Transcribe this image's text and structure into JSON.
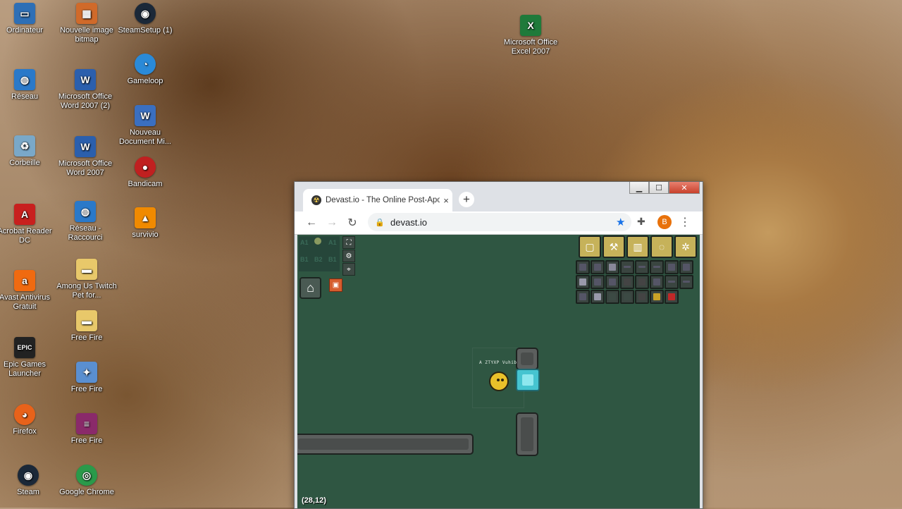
{
  "desktop": {
    "icons": [
      {
        "label": "Ordinateur",
        "icon": "computer-icon",
        "color": "#2e6fb6"
      },
      {
        "label": "Nouvelle image bitmap",
        "icon": "bitmap-icon",
        "color": "#d06a2a"
      },
      {
        "label": "SteamSetup (1)",
        "icon": "steam-icon",
        "color": "#1b2838"
      },
      {
        "label": "Réseau",
        "icon": "network-icon",
        "color": "#2a79c9"
      },
      {
        "label": "Microsoft Office Word 2007 (2)",
        "icon": "word-icon",
        "color": "#2b5fad"
      },
      {
        "label": "Gameloop",
        "icon": "gameloop-icon",
        "color": "#2a8ad8"
      },
      {
        "label": "Corbeille",
        "icon": "recycle-bin-icon",
        "color": "#7aa8c8"
      },
      {
        "label": "Microsoft Office Word 2007",
        "icon": "word-icon",
        "color": "#2b5fad"
      },
      {
        "label": "Nouveau Document Mi...",
        "icon": "document-icon",
        "color": "#3a6fc0"
      },
      {
        "label": "Acrobat Reader DC",
        "icon": "acrobat-icon",
        "color": "#c8201e"
      },
      {
        "label": "Réseau - Raccourci",
        "icon": "network-shortcut-icon",
        "color": "#2a79c9"
      },
      {
        "label": "Bandicam",
        "icon": "bandicam-icon",
        "color": "#c02020"
      },
      {
        "label": "survivio",
        "icon": "vlc-icon",
        "color": "#f08a00"
      },
      {
        "label": "Avast Antivirus Gratuit",
        "icon": "avast-icon",
        "color": "#f06a10"
      },
      {
        "label": "Among Us Twitch Pet for...",
        "icon": "folder-icon",
        "color": "#e8c86a"
      },
      {
        "label": "Free Fire",
        "icon": "folder-icon",
        "color": "#e8c86a"
      },
      {
        "label": "Epic Games Launcher",
        "icon": "epic-icon",
        "color": "#222222"
      },
      {
        "label": "Free Fire",
        "icon": "freefire-icon",
        "color": "#5a8fd0"
      },
      {
        "label": "Firefox",
        "icon": "firefox-icon",
        "color": "#e8621a"
      },
      {
        "label": "Free Fire",
        "icon": "winrar-icon",
        "color": "#8a2a6a"
      },
      {
        "label": "Steam",
        "icon": "steam-icon",
        "color": "#1b2838"
      },
      {
        "label": "Google Chrome",
        "icon": "chrome-icon",
        "color": "#2a9a4a"
      },
      {
        "label": "Microsoft Office Excel 2007",
        "icon": "excel-icon",
        "color": "#1f7a3a"
      }
    ]
  },
  "browser": {
    "tab_title": "Devast.io - The Online Post-Apoc",
    "tab_close": "×",
    "new_tab": "+",
    "url": "devast.io",
    "profile_initial": "B",
    "window_controls": {
      "minimize": "▁",
      "maximize": "☐",
      "close": "✕"
    }
  },
  "game": {
    "minimap_cells": [
      "A1",
      "A1",
      "B1",
      "B2",
      "B1"
    ],
    "player_name": "A ZTYXP Vuhib",
    "coordinates": "(28,12)",
    "accent_gold": "#c6b25a",
    "background": "#2f5642"
  }
}
